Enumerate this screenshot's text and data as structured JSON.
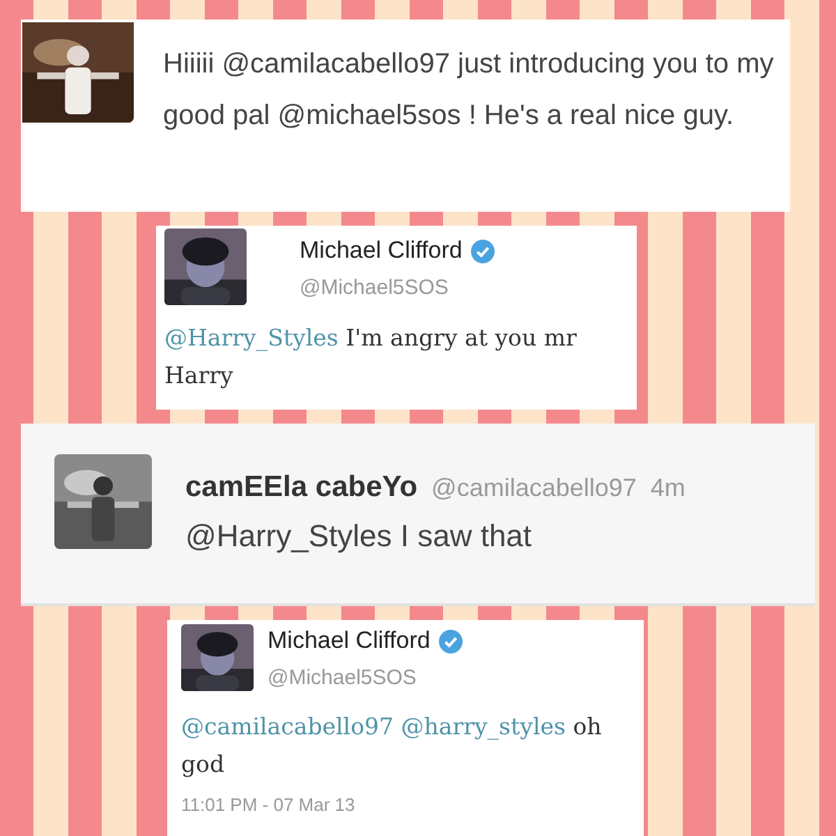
{
  "tweets": [
    {
      "kind": "plain",
      "avatar": {
        "kind": "picture"
      },
      "text": [
        {
          "kind": "text",
          "t": "Hiiiii @camilacabello97 just introducing you to my good pal @michael5sos ! He's a real nice guy."
        }
      ]
    },
    {
      "kind": "card",
      "name": "Michael Clifford",
      "verified": true,
      "handle": "@Michael5SOS",
      "avatar": {
        "kind": "picture"
      },
      "text": [
        {
          "kind": "mention",
          "t": "@Harry_Styles"
        },
        {
          "kind": "text",
          "t": " I'm angry at you mr Harry"
        }
      ]
    },
    {
      "kind": "inline",
      "name": "camEEla cabeYo",
      "handle": "@camilacabello97",
      "time": "4m",
      "avatar": {
        "kind": "picture"
      },
      "text": [
        {
          "kind": "text",
          "t": "@Harry_Styles I saw that"
        }
      ]
    },
    {
      "kind": "card",
      "name": "Michael Clifford",
      "verified": true,
      "handle": "@Michael5SOS",
      "avatar": {
        "kind": "picture"
      },
      "text": [
        {
          "kind": "mention",
          "t": "@camilacabello97 @harry_styles"
        },
        {
          "kind": "text",
          "t": " oh god"
        }
      ],
      "timestamp": "11:01 PM - 07 Mar 13"
    }
  ]
}
